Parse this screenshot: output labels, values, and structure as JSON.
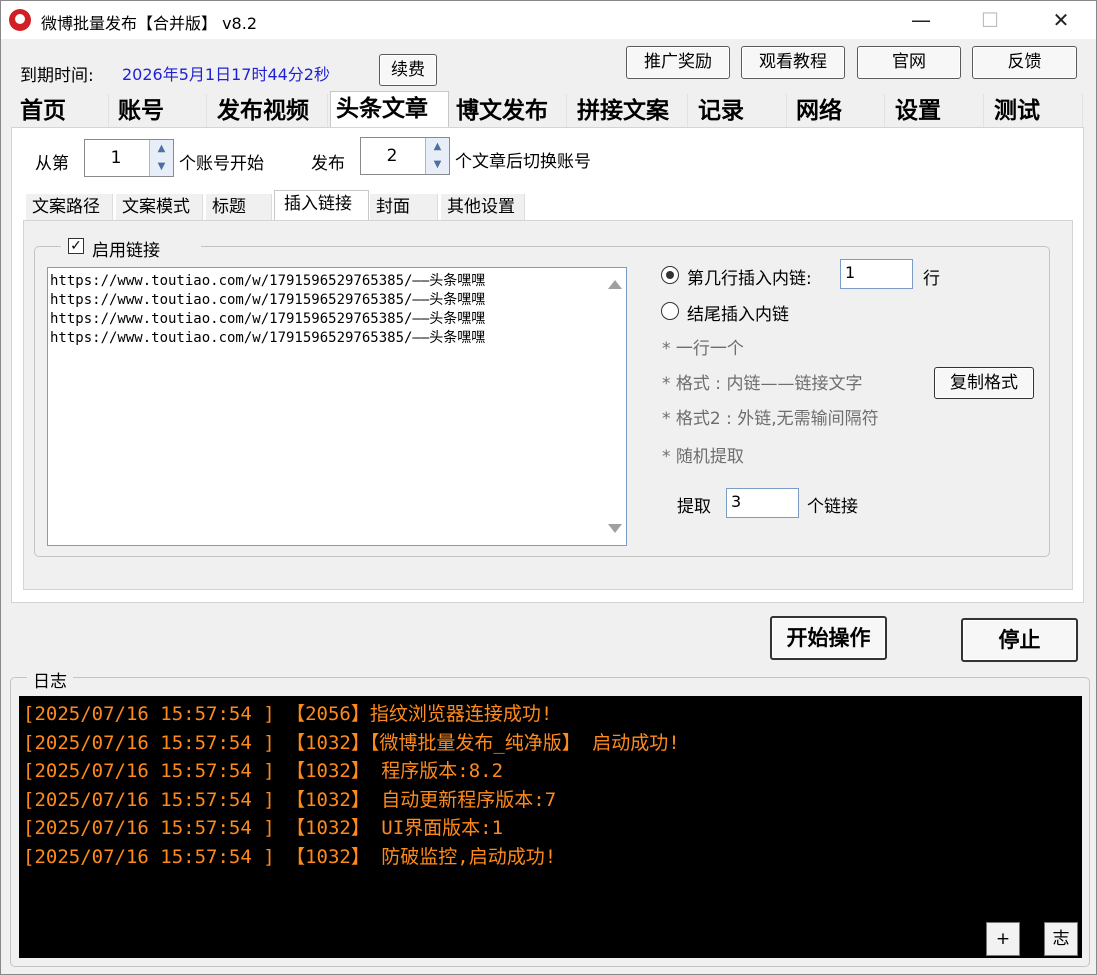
{
  "window": {
    "title": "微博批量发布【合并版】  v8.2",
    "minimize": "—",
    "maximize": "☐",
    "close": "✕"
  },
  "header": {
    "expire_label": "到期时间:",
    "expire_value": "2026年5月1日17时44分2秒",
    "renew_button": "续费",
    "buttons": [
      "推广奖励",
      "观看教程",
      "官网",
      "反馈"
    ],
    "accent_color": "#1f1fd6"
  },
  "main_tabs": [
    "首页",
    "账号",
    "发布视频",
    "头条文章",
    "博文发布",
    "拼接文案",
    "记录",
    "网络",
    "设置",
    "测试"
  ],
  "switch_settings": {
    "start_prefix": "从第",
    "start_value": "1",
    "start_suffix": "个账号开始",
    "publish_prefix": "发布",
    "publish_value": "2",
    "publish_suffix": "个文章后切换账号"
  },
  "sub_tabs": [
    "文案路径",
    "文案模式",
    "标题",
    "插入链接",
    "封面",
    "其他设置"
  ],
  "insert_link": {
    "enable_label": "启用链接",
    "enable_checked": true,
    "links": [
      "https://www.toutiao.com/w/1791596529765385/——头条嘿嘿",
      "https://www.toutiao.com/w/1791596529765385/——头条嘿嘿",
      "https://www.toutiao.com/w/1791596529765385/——头条嘿嘿",
      "https://www.toutiao.com/w/1791596529765385/——头条嘿嘿"
    ],
    "option_line_label": "第几行插入内链:",
    "option_line_value": "1",
    "option_line_unit": "行",
    "option_end_label": "结尾插入内链",
    "hints": [
      "* 一行一个",
      "* 格式 : 内链——链接文字",
      "* 格式2 : 外链,无需输间隔符",
      "* 随机提取"
    ],
    "copy_format_button": "复制格式",
    "extract_label": "提取",
    "extract_value": "3",
    "extract_unit": "个链接"
  },
  "actions": {
    "start": "开始操作",
    "stop": "停止"
  },
  "log": {
    "label": "日志",
    "text_color": "#ff8a1c",
    "lines": [
      "[2025/07/16 15:57:54 ]  【2056】指纹浏览器连接成功!",
      "[2025/07/16 15:57:54 ]  【1032】【微博批量发布_纯净版】 启动成功!",
      "[2025/07/16 15:57:54 ]  【1032】 程序版本:8.2",
      "[2025/07/16 15:57:54 ]  【1032】 自动更新程序版本:7",
      "[2025/07/16 15:57:54 ]  【1032】 UI界面版本:1",
      "[2025/07/16 15:57:54 ]  【1032】 防破监控,启动成功!"
    ],
    "plus_button": "+",
    "log_button": "志"
  }
}
